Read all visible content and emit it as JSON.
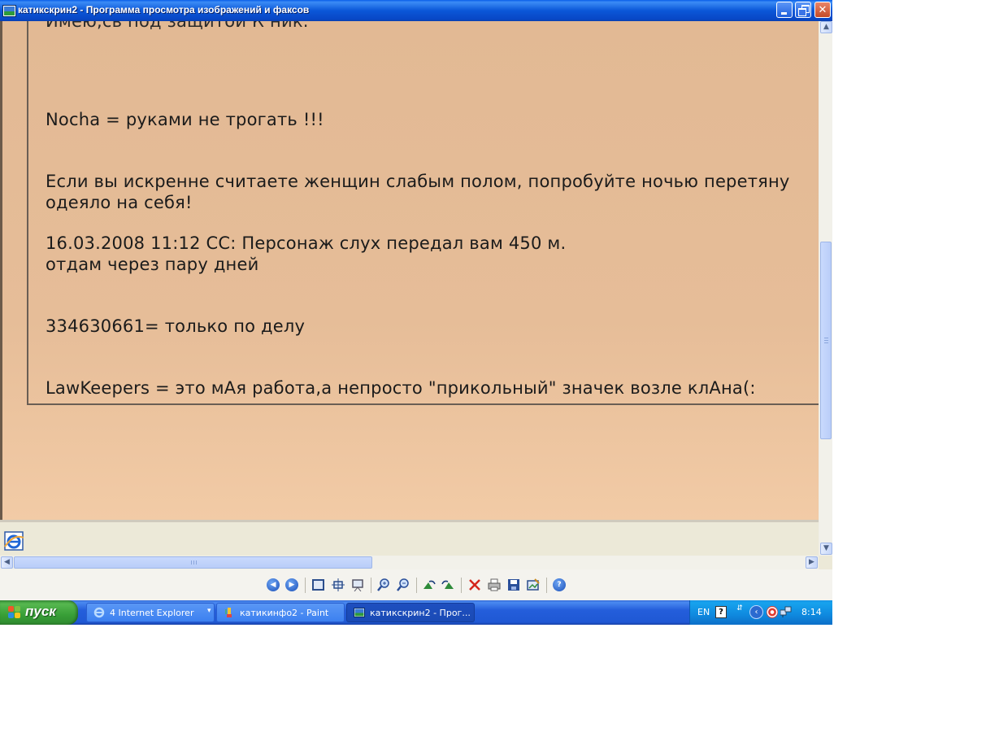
{
  "window": {
    "title": "катикскрин2 - Программа просмотра изображений и факсов",
    "colors": {
      "titlebar": "#0b57d8",
      "close": "#c44a26",
      "image_background": "#e6bd98",
      "taskbar": "#245edb",
      "start": "#389f37",
      "tray": "#0f89df"
    }
  },
  "image_text": {
    "line_top_clipped": "Имею,св под защитой К ник.",
    "line_nocha": "Nocha = руками не трогать !!!",
    "line_women_1": "Если вы искренне считаете женщин слабым полом, попробуйте ночью перетяну",
    "line_women_2": "одеяло на себя!",
    "line_date": "16.03.2008 11:12 СС: Персонаж слух передал вам 450 м.",
    "line_return": "отдам через пару дней",
    "line_icq": "334630661= только по делу",
    "line_lawkeepers": "LawKeepers = это мАя работа,а непросто \"прикольный\" значек возле клАна(:"
  },
  "toolbar": {
    "icons": [
      "previous-image-icon",
      "next-image-icon",
      "best-fit-icon",
      "actual-size-icon",
      "slideshow-icon",
      "zoom-in-icon",
      "zoom-out-icon",
      "rotate-clockwise-icon",
      "rotate-counterclockwise-icon",
      "delete-icon",
      "print-icon",
      "save-icon",
      "edit-icon",
      "help-icon"
    ]
  },
  "taskbar": {
    "start_label": "пуск",
    "tasks": [
      {
        "label": "4 Internet Explorer",
        "icon": "internet-explorer-icon",
        "active": false
      },
      {
        "label": "катикинфо2 - Paint",
        "icon": "paint-icon",
        "active": false
      },
      {
        "label": "катикскрин2 - Прог...",
        "icon": "image-viewer-icon",
        "active": true
      }
    ],
    "tray": {
      "language": "EN",
      "clock": "8:14"
    }
  }
}
